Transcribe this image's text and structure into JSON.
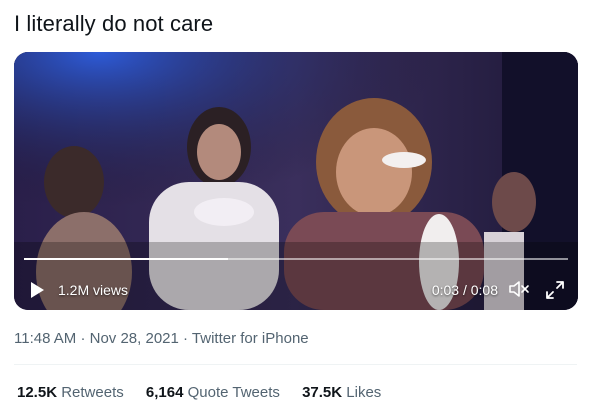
{
  "tweet": {
    "text": "I literally do not care"
  },
  "video": {
    "views": "1.2M views",
    "time": "0:03 / 0:08",
    "progress": 0.375,
    "icons": {
      "play": "play-icon",
      "mute": "volume-muted-icon",
      "expand": "expand-icon"
    }
  },
  "meta": {
    "time": "11:48 AM",
    "date": "Nov 28, 2021",
    "source": "Twitter for iPhone",
    "separator": "·"
  },
  "stats": {
    "retweets_count": "12.5K",
    "retweets_label": "Retweets",
    "quotes_count": "6,164",
    "quotes_label": "Quote Tweets",
    "likes_count": "37.5K",
    "likes_label": "Likes"
  }
}
